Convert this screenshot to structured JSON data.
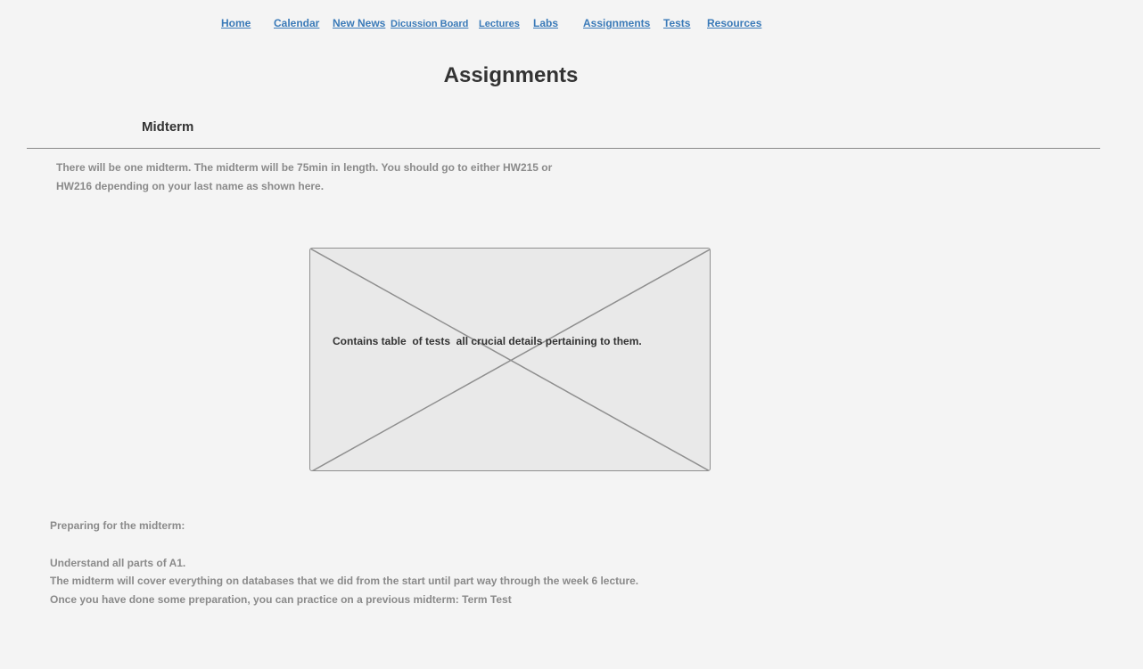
{
  "nav": {
    "home": "Home",
    "calendar": "Calendar",
    "news": "New News",
    "discussion": "Dicussion Board",
    "lectures": "Lectures",
    "labs": "Labs",
    "assignments": "Assignments",
    "tests": "Tests",
    "resources": "Resources"
  },
  "page": {
    "title": "Assignments",
    "section_heading": "Midterm",
    "intro": "There will be one midterm. The midterm will be 75min in length. You should go to either HW215 or HW216 depending on your last name as shown here.",
    "image_caption": "Contains table  of tests  all crucial details pertaining to them.",
    "prep_heading": "Preparing for the midterm:",
    "prep_lines": [
      "Understand all parts of A1.",
      "The midterm will cover everything on databases that we did from the start until part way through the week 6 lecture.",
      "Once you have done some preparation, you can practice on a previous midterm: Term Test"
    ]
  }
}
